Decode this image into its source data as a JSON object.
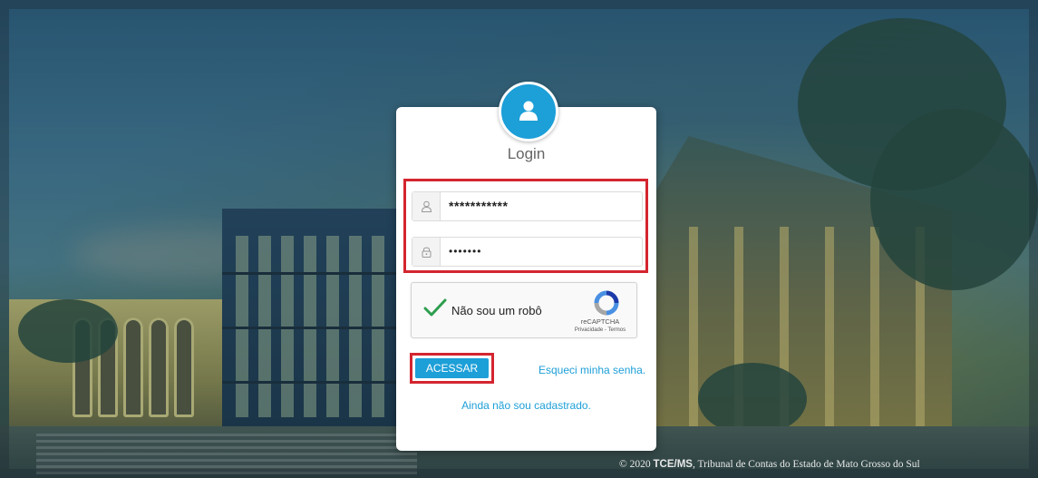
{
  "login": {
    "title": "Login",
    "username_value": "***********",
    "password_value": "•••••••",
    "submit_label": "ACESSAR",
    "forgot_link": "Esqueci minha senha.",
    "register_link": "Ainda não sou cadastrado."
  },
  "recaptcha": {
    "label": "Não sou um robô",
    "brand": "reCAPTCHA",
    "links": "Privacidade - Termos",
    "checked": true
  },
  "footer": {
    "copyright": "© 2020",
    "org_short": "TCE/MS",
    "org_full": ", Tribunal de Contas do Estado de Mato Grosso do Sul"
  },
  "icons": {
    "avatar": "user-icon",
    "username": "user-outline-icon",
    "password": "lock-icon",
    "captcha_check": "checkmark-icon",
    "captcha_logo": "recaptcha-logo-icon"
  },
  "colors": {
    "accent": "#1d9fd8",
    "highlight": "#d4252f",
    "check": "#2e9e4f"
  }
}
